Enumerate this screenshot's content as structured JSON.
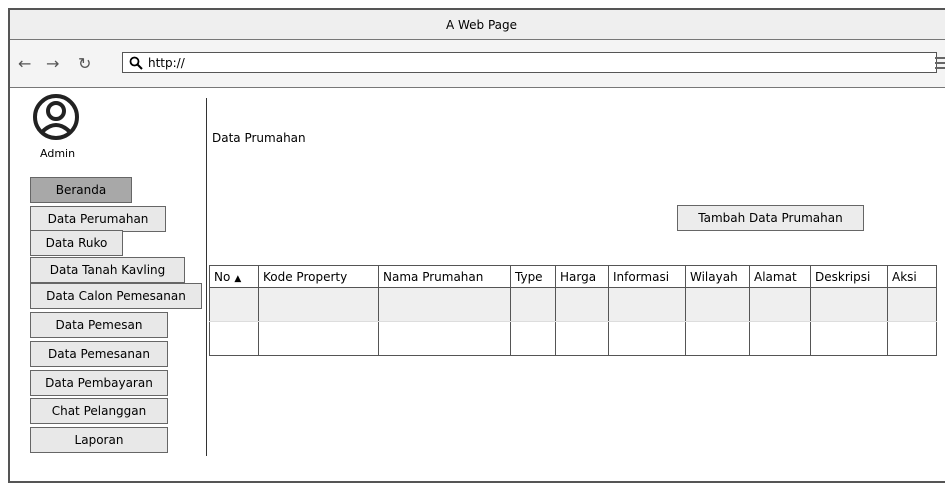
{
  "window": {
    "title": "A Web Page"
  },
  "toolbar": {
    "url": "http://"
  },
  "sidebar": {
    "user": "Admin",
    "items": [
      {
        "label": "Beranda"
      },
      {
        "label": "Data Perumahan"
      },
      {
        "label": "Data Ruko"
      },
      {
        "label": "Data Tanah Kavling"
      },
      {
        "label": "Data Calon Pemesanan"
      },
      {
        "label": "Data Pemesan"
      },
      {
        "label": "Data Pemesanan"
      },
      {
        "label": "Data Pembayaran"
      },
      {
        "label": "Chat Pelanggan"
      },
      {
        "label": "Laporan"
      }
    ]
  },
  "main": {
    "title": "Data Prumahan",
    "add_button": "Tambah Data Prumahan",
    "table": {
      "columns": [
        "No",
        "Kode Property",
        "Nama Prumahan",
        "Type",
        "Harga",
        "Informasi",
        "Wilayah",
        "Alamat",
        "Deskripsi",
        "Aksi"
      ],
      "sort_indicator": "▲"
    }
  }
}
